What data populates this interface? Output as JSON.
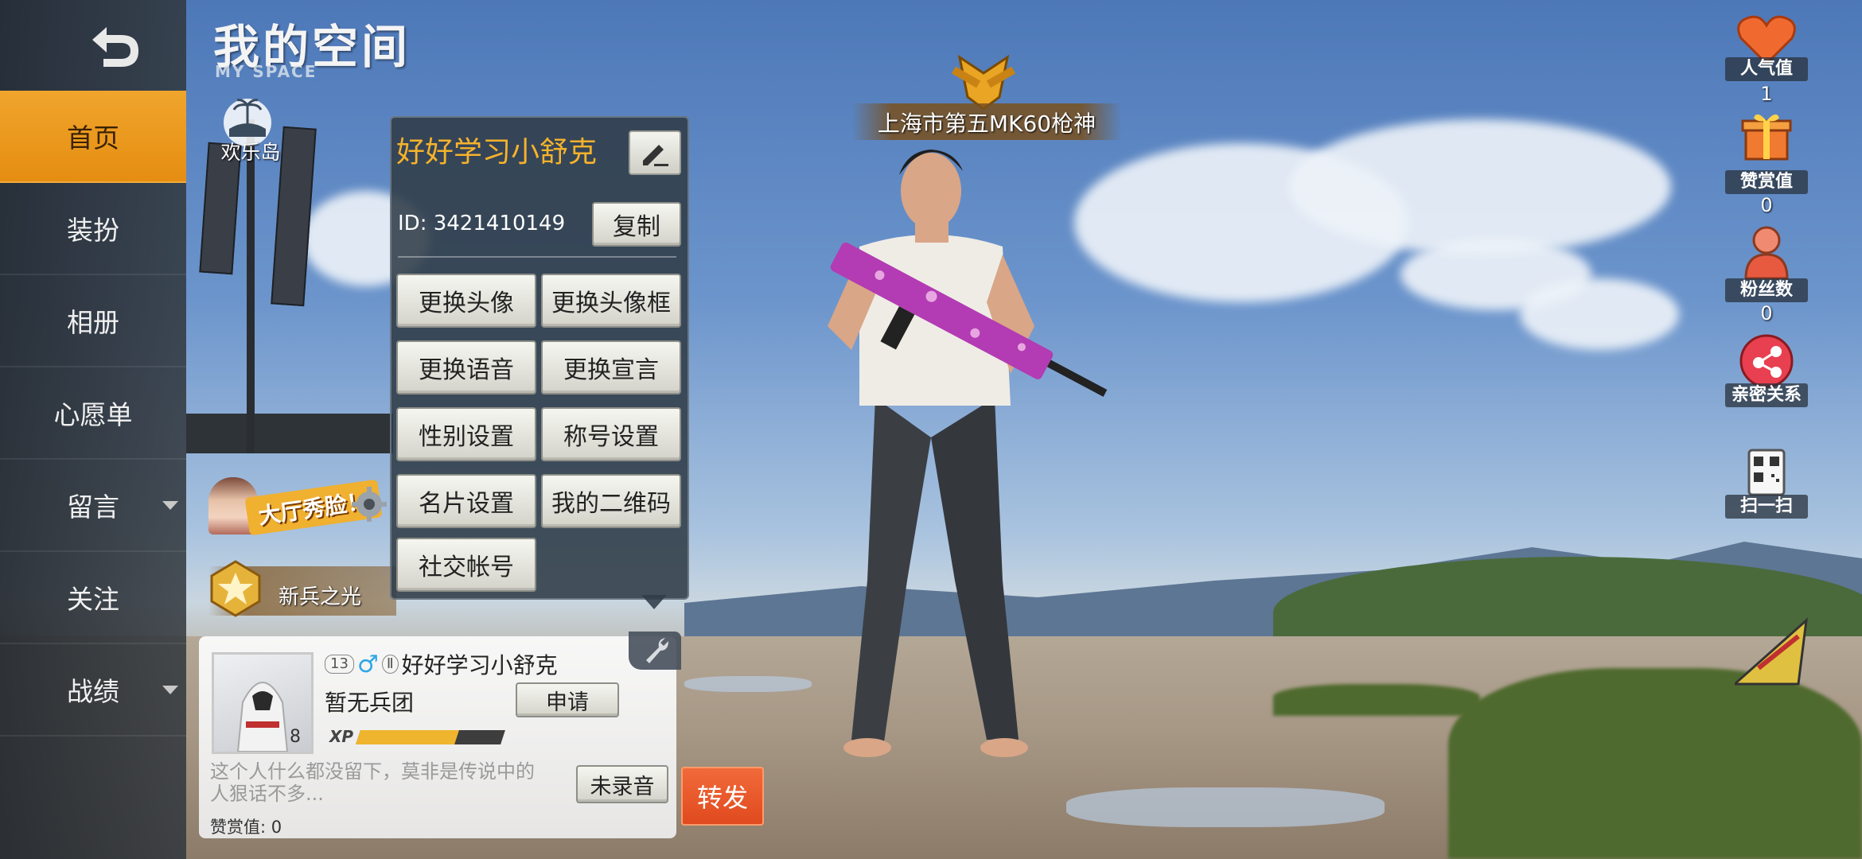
{
  "page": {
    "title": "我的空间",
    "subtitle": "MY SPACE"
  },
  "sidebar": {
    "items": [
      {
        "label": "首页",
        "active": true
      },
      {
        "label": "装扮"
      },
      {
        "label": "相册"
      },
      {
        "label": "心愿单"
      },
      {
        "label": "留言",
        "has_dropdown": true
      },
      {
        "label": "关注"
      },
      {
        "label": "战绩",
        "has_dropdown": true
      }
    ]
  },
  "island": {
    "label": "欢乐岛"
  },
  "lobby_banner": {
    "label": "大厅秀脸！"
  },
  "rank": {
    "label": "新兵之光"
  },
  "profile_popup": {
    "name": "好好学习小舒克",
    "id_text": "ID: 3421410149",
    "copy_label": "复制",
    "buttons": [
      "更换头像",
      "更换头像框",
      "更换语音",
      "更换宣言",
      "性别设置",
      "称号设置",
      "名片设置",
      "我的二维码",
      "社交帐号"
    ]
  },
  "player_card": {
    "level_badge": "13",
    "name": "好好学习小舒克",
    "legion": "暂无兵团",
    "apply_label": "申请",
    "avatar_level": "8",
    "xp_label": "XP",
    "xp_progress": 0.68,
    "motto": "这个人什么都没留下，莫非是传说中的人狠话不多...",
    "voice_label": "未录音",
    "praise": "赞赏值: 0",
    "share_label": "转发"
  },
  "honor_title": {
    "text": "上海市第五MK60枪神"
  },
  "right_stats": [
    {
      "label": "人气值",
      "value": "1",
      "icon": "heart-icon"
    },
    {
      "label": "赞赏值",
      "value": "0",
      "icon": "gift-icon"
    },
    {
      "label": "粉丝数",
      "value": "0",
      "icon": "fans-icon"
    },
    {
      "label": "亲密关系",
      "value": "",
      "icon": "share-icon"
    },
    {
      "label": "扫一扫",
      "value": "",
      "icon": "qr-icon"
    }
  ],
  "colors": {
    "accent": "#f0a52c",
    "name_gold": "#f7b32a",
    "share_red": "#e04a1e",
    "male_blue": "#2fa7e6"
  }
}
